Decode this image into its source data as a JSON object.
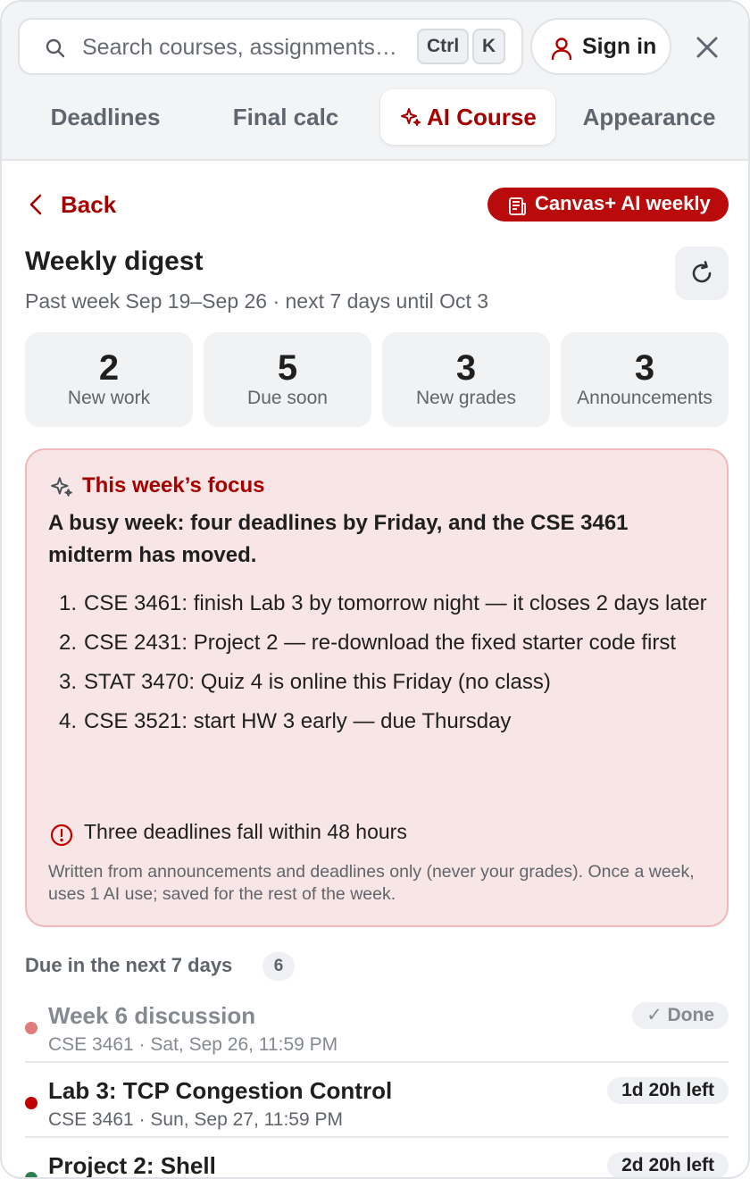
{
  "search": {
    "placeholder": "Search courses, assignments…",
    "kbd_ctrl": "Ctrl",
    "kbd_k": "K"
  },
  "header": {
    "sign_in": "Sign in"
  },
  "tabs": [
    {
      "label": "Deadlines"
    },
    {
      "label": "Final calc"
    },
    {
      "label": "AI Course"
    },
    {
      "label": "Appearance"
    }
  ],
  "nav": {
    "back": "Back",
    "badge": "Canvas+ AI weekly"
  },
  "digest": {
    "title": "Weekly digest",
    "subtitle": "Past week Sep 19–Sep 26 · next 7 days until Oct 3"
  },
  "stats": [
    {
      "value": "2",
      "label": "New work"
    },
    {
      "value": "5",
      "label": "Due soon"
    },
    {
      "value": "3",
      "label": "New grades"
    },
    {
      "value": "3",
      "label": "Announcements"
    }
  ],
  "focus": {
    "label": "This week’s focus",
    "headline": "A busy week: four deadlines by Friday, and the CSE 3461 midterm has moved.",
    "items": [
      {
        "n": "1.",
        "text": "CSE 3461: finish Lab 3 by tomorrow night — it closes 2 days later"
      },
      {
        "n": "2.",
        "text": "CSE 2431: Project 2 — re-download the fixed starter code first"
      },
      {
        "n": "3.",
        "text": "STAT 3470: Quiz 4 is online this Friday (no class)"
      },
      {
        "n": "4.",
        "text": "CSE 3521: start HW 3 early — due Thursday"
      }
    ],
    "warning": "Three deadlines fall within 48 hours",
    "footnote": "Written from announcements and deadlines only (never your grades). Once a week, uses 1 AI use; saved for the rest of the week."
  },
  "due": {
    "heading": "Due in the next 7 days",
    "count": "6",
    "items": [
      {
        "title": "Week 6 discussion",
        "meta": "CSE 3461 · Sat, Sep 26, 11:59 PM",
        "status": "✓ Done",
        "dot_color": "#e07b7b",
        "done": true
      },
      {
        "title": "Lab 3: TCP Congestion Control",
        "meta": "CSE 3461 · Sun, Sep 27, 11:59 PM",
        "status": "1d 20h left",
        "dot_color": "#c00000",
        "done": false
      },
      {
        "title": "Project 2: Shell",
        "meta": "",
        "status": "2d 20h left",
        "dot_color": "#2f7d50",
        "done": false
      }
    ]
  },
  "colors": {
    "accent": "#a40000",
    "badge_bg": "#b90b0b",
    "focus_bg": "#f8e5e5",
    "focus_border": "#f0b8b8"
  }
}
